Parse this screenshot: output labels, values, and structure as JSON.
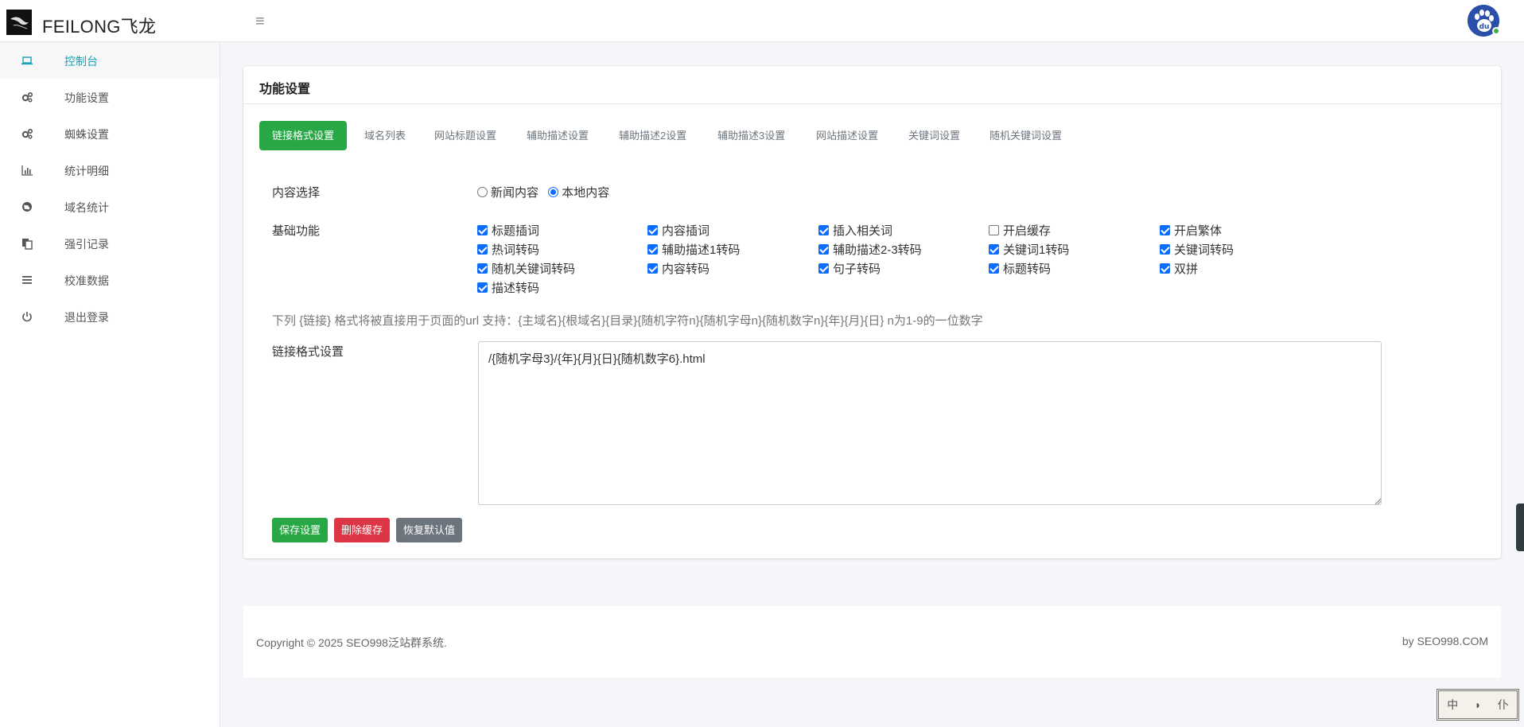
{
  "header": {
    "brand": "FEILONG飞龙"
  },
  "sidebar": {
    "items": [
      {
        "label": "控制台",
        "icon": "laptop-icon"
      },
      {
        "label": "功能设置",
        "icon": "gears-icon"
      },
      {
        "label": "蜘蛛设置",
        "icon": "gears-icon"
      },
      {
        "label": "统计明细",
        "icon": "bar-chart-icon"
      },
      {
        "label": "域名统计",
        "icon": "globe-icon"
      },
      {
        "label": "强引记录",
        "icon": "copy-icon"
      },
      {
        "label": "校准数据",
        "icon": "list-icon"
      },
      {
        "label": "退出登录",
        "icon": "power-icon"
      }
    ]
  },
  "card": {
    "title": "功能设置",
    "tabs": [
      "链接格式设置",
      "域名列表",
      "网站标题设置",
      "辅助描述设置",
      "辅助描述2设置",
      "辅助描述3设置",
      "网站描述设置",
      "关键词设置",
      "随机关键词设置"
    ],
    "content_select": {
      "label": "内容选择",
      "options": [
        {
          "label": "新闻内容",
          "checked": false
        },
        {
          "label": "本地内容",
          "checked": true
        }
      ]
    },
    "basic_functions": {
      "label": "基础功能",
      "options": [
        {
          "label": "标题插词",
          "checked": true
        },
        {
          "label": "内容插词",
          "checked": true
        },
        {
          "label": "插入相关词",
          "checked": true
        },
        {
          "label": "开启缓存",
          "checked": false
        },
        {
          "label": "开启繁体",
          "checked": true
        },
        {
          "label": "热词转码",
          "checked": true
        },
        {
          "label": "辅助描述1转码",
          "checked": true
        },
        {
          "label": "辅助描述2-3转码",
          "checked": true
        },
        {
          "label": "关键词1转码",
          "checked": true
        },
        {
          "label": "关键词转码",
          "checked": true
        },
        {
          "label": "随机关键词转码",
          "checked": true
        },
        {
          "label": "内容转码",
          "checked": true
        },
        {
          "label": "句子转码",
          "checked": true
        },
        {
          "label": "标题转码",
          "checked": true
        },
        {
          "label": "双拼",
          "checked": true
        },
        {
          "label": "描述转码",
          "checked": true
        }
      ]
    },
    "hint": "下列 {链接} 格式将被直接用于页面的url 支持：{主域名}{根域名}{目录}{随机字符n}{随机字母n}{随机数字n}{年}{月}{日} n为1-9的一位数字",
    "link_format": {
      "label": "链接格式设置",
      "value": "/{随机字母3}/{年}{月}{日}{随机数字6}.html"
    },
    "buttons": {
      "save": "保存设置",
      "delete_cache": "删除缓存",
      "reset": "恢复默认值"
    }
  },
  "footer": {
    "copyright": "Copyright © 2025 SEO998泛站群系统.",
    "byline": "by SEO998.COM"
  },
  "colors": {
    "accent": "#17a2b8",
    "success": "#28a745",
    "danger": "#dc3545",
    "secondary": "#6c757d",
    "checkbox": "#0d6efd"
  }
}
